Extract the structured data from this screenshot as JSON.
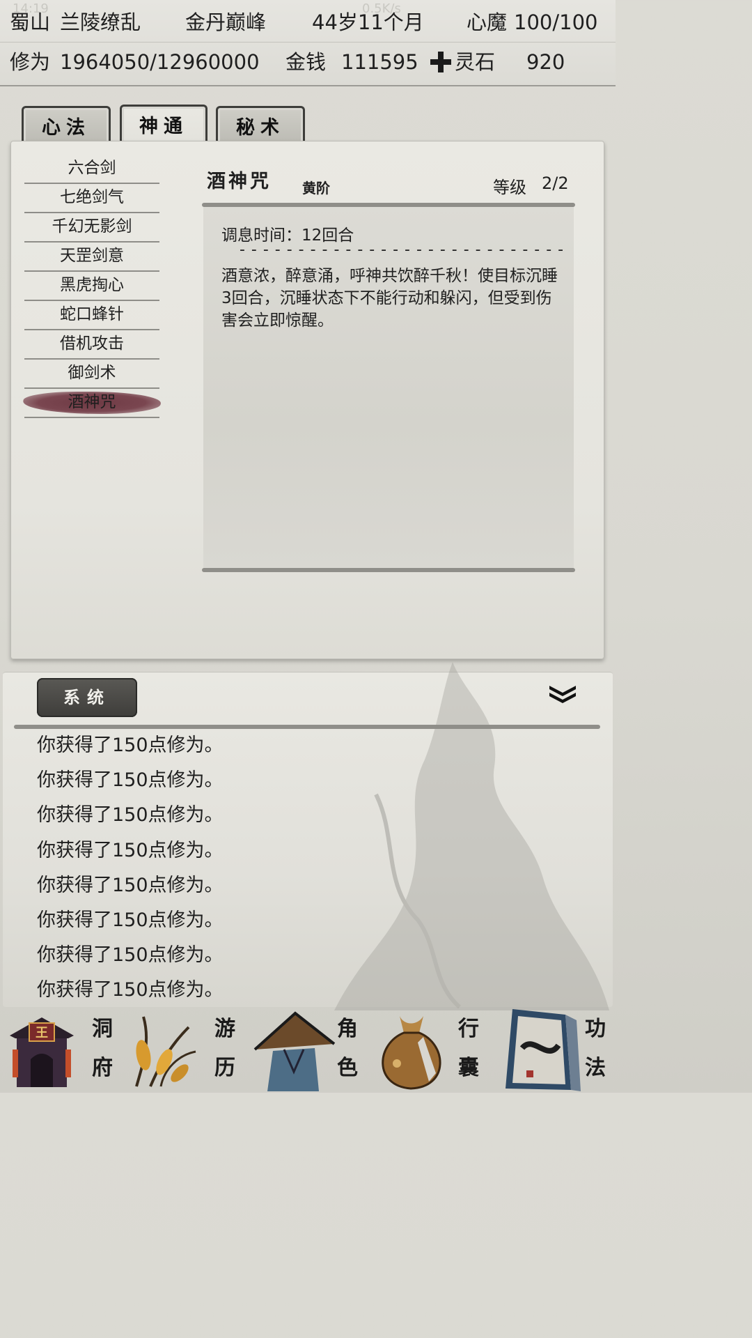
{
  "status_bar": {
    "time": "14:19",
    "speed": "0.5K/s"
  },
  "header": {
    "sect": "蜀山",
    "name": "兰陵缭乱",
    "realm": "金丹巅峰",
    "age": "44岁11个月",
    "heart_demon_label": "心魔",
    "heart_demon_value": "100/100",
    "cultivation_label": "修为",
    "cultivation_value": "1964050/12960000",
    "money_label": "金钱",
    "money_value": "111595",
    "spirit_stone_label": "灵石",
    "spirit_stone_value": "920"
  },
  "tabs": [
    {
      "label": "心法",
      "active": false
    },
    {
      "label": "神通",
      "active": true
    },
    {
      "label": "秘术",
      "active": false
    }
  ],
  "skills": [
    "六合剑",
    "七绝剑气",
    "千幻无影剑",
    "天罡剑意",
    "黑虎掏心",
    "蛇口蜂针",
    "借机攻击",
    "御剑术",
    "酒神咒"
  ],
  "selected_skill": {
    "name": "酒神咒",
    "grade": "黄阶",
    "level_label": "等级",
    "level_value": "2/2",
    "cooldown": "调息时间：12回合",
    "divider": "- - - - - - - - - - - - - - - - - - - - - - - - - - - -",
    "description": "酒意浓，醉意涌，呼神共饮醉千秋！使目标沉睡3回合，沉睡状态下不能行动和躲闪，但受到伤害会立即惊醒。"
  },
  "log": {
    "tab_label": "系统",
    "lines": [
      "你获得了150点修为。",
      "你获得了150点修为。",
      "你获得了150点修为。",
      "你获得了150点修为。",
      "你获得了150点修为。",
      "你获得了150点修为。",
      "你获得了150点修为。",
      "你获得了150点修为。"
    ]
  },
  "nav": {
    "cave": [
      "洞",
      "府"
    ],
    "travel": [
      "游",
      "历"
    ],
    "character": [
      "角",
      "色"
    ],
    "bag": [
      "行",
      "囊"
    ],
    "skills": [
      "功",
      "法"
    ],
    "cave_badge": "王"
  }
}
